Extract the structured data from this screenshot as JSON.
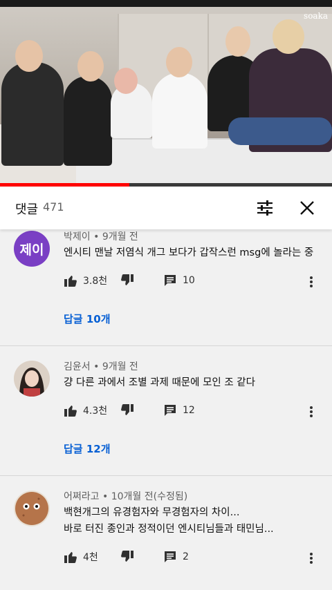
{
  "video": {
    "watermark": "soaka",
    "progress_fraction": 0.39
  },
  "header": {
    "title": "댓글",
    "count": "471",
    "filter_icon": "filter-sliders-icon",
    "close_icon": "close-icon"
  },
  "comments": [
    {
      "author": "박제이",
      "time": "9개월 전",
      "avatar_text": "제이",
      "avatar_color": "#7a3fc4",
      "lines": [
        "엔시티 맨날 저염식 개그 보다가 갑작스런 msg에 놀라는 중"
      ],
      "likes": "3.8천",
      "reply_count": "10",
      "replies_label": "답글 10개"
    },
    {
      "author": "김윤서",
      "time": "9개월 전",
      "avatar_text": "",
      "lines": [
        "걍 다른 과에서 조별 과제 때문에 모인 조 같다"
      ],
      "likes": "4.3천",
      "reply_count": "12",
      "replies_label": "답글 12개"
    },
    {
      "author": "어쩌라고",
      "time": "10개월 전(수정됨)",
      "avatar_text": "",
      "lines": [
        "백현개그의 유경험자와 무경험자의 차이...",
        "바로 터진 종인과 정적이던 엔시티님들과 태민님..."
      ],
      "likes": "4천",
      "reply_count": "2"
    }
  ],
  "colors": {
    "accent_blue": "#065fd4",
    "progress_red": "#ff0000"
  }
}
